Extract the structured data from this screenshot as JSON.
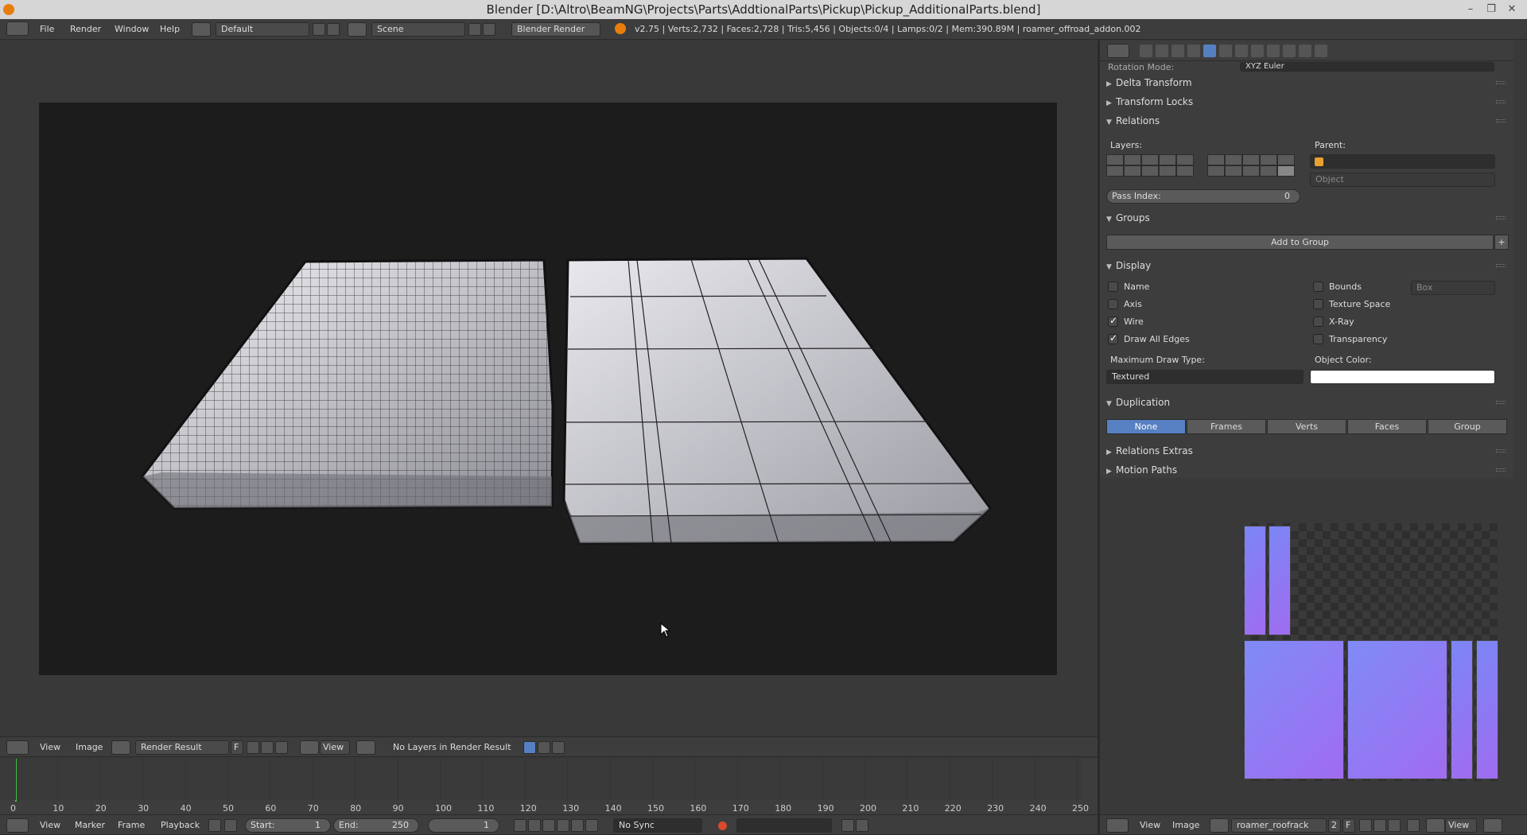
{
  "window": {
    "title": "Blender [D:\\Altro\\BeamNG\\Projects\\Parts\\AddtionalParts\\Pickup\\Pickup_AdditionalParts.blend]"
  },
  "info_header": {
    "menus": [
      "File",
      "Render",
      "Window",
      "Help"
    ],
    "screen_layout": "Default",
    "scene": "Scene",
    "render_engine": "Blender Render",
    "stats": "v2.75 | Verts:2,732 | Faces:2,728 | Tris:5,456 | Objects:0/4 | Lamps:0/2 | Mem:390.89M | roamer_offroad_addon.002"
  },
  "properties": {
    "rotation_mode_label": "Rotation Mode:",
    "rotation_mode_value": "XYZ Euler",
    "panels": {
      "delta_transform": "Delta Transform",
      "transform_locks": "Transform Locks",
      "relations": "Relations",
      "groups": "Groups",
      "display": "Display",
      "duplication": "Duplication",
      "relations_extras": "Relations Extras",
      "motion_paths": "Motion Paths"
    },
    "relations": {
      "layers_label": "Layers:",
      "parent_label": "Parent:",
      "parent_type": "Object",
      "pass_index_label": "Pass Index:",
      "pass_index_value": "0"
    },
    "groups": {
      "add_button": "Add to Group"
    },
    "display": {
      "name": "Name",
      "axis": "Axis",
      "wire": "Wire",
      "draw_all_edges": "Draw All Edges",
      "bounds": "Bounds",
      "bounds_type": "Box",
      "texture_space": "Texture Space",
      "xray": "X-Ray",
      "transparency": "Transparency",
      "max_draw_type_label": "Maximum Draw Type:",
      "max_draw_type_value": "Textured",
      "object_color_label": "Object Color:",
      "object_color": "#ffffff",
      "wire_checked": true,
      "draw_all_edges_checked": true
    },
    "duplication": {
      "options": [
        "None",
        "Frames",
        "Verts",
        "Faces",
        "Group"
      ],
      "active": "None"
    }
  },
  "image_header": {
    "menus": [
      "View",
      "Image"
    ],
    "image_name": "Render Result",
    "fake_user": "F",
    "view": "View",
    "status": "No Layers in Render Result"
  },
  "timeline": {
    "ticks": [
      "0",
      "10",
      "20",
      "30",
      "40",
      "50",
      "60",
      "70",
      "80",
      "90",
      "100",
      "110",
      "120",
      "130",
      "140",
      "150",
      "160",
      "170",
      "180",
      "190",
      "200",
      "210",
      "220",
      "230",
      "240",
      "250"
    ],
    "current_frame": 1,
    "frame_range": [
      0,
      250
    ]
  },
  "timeline_header": {
    "menus": [
      "View",
      "Marker",
      "Frame",
      "Playback"
    ],
    "start_label": "Start:",
    "start_value": "1",
    "end_label": "End:",
    "end_value": "250",
    "current_value": "1",
    "sync": "No Sync"
  },
  "uv_header": {
    "menus": [
      "View",
      "Image"
    ],
    "image_name": "roamer_roofrack",
    "users": "2",
    "fake_user": "F",
    "view": "View"
  },
  "colors": {
    "accent": "#5680c2",
    "normal_map": "#8a7cf7",
    "timeline_cursor": "#44c444"
  }
}
